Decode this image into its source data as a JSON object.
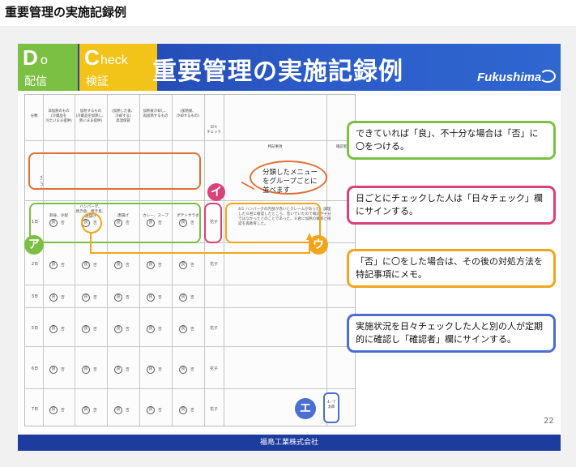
{
  "page": {
    "heading": "重要管理の実施記録例"
  },
  "slide": {
    "tile_do_big": "D",
    "tile_do_rest": "o",
    "tile_do_sub": "配信",
    "tile_check_big": "C",
    "tile_check_rest": "heck",
    "tile_check_sub": "検証",
    "title": "重要管理の実施記録例",
    "brand": "Fukushima",
    "page_number": "22",
    "footer": "福島工業株式会社"
  },
  "table": {
    "col_headers": [
      "分類",
      "非加熱のもの\n(冷蔵品を\n冷たいまま提供)",
      "加熱するもの\n(冷蔵品を加熱し、\n熱いまま提供)",
      "(加熱した後、\n冷却する)\n高温保管",
      "加熱後冷却し、\n再加熱するもの",
      "(加熱後、\n冷却するもの)",
      "日々\nチェック",
      "特記事項",
      "確認者"
    ],
    "menu_label": "メニュー",
    "menus": [
      "刺身、冷奴",
      "ハンバーグ、\n焼き魚、焼き鳥、\n唐揚げ",
      "唐揚げ",
      "カレー、スープ",
      "ポテトサラダ"
    ],
    "days": [
      "1日",
      "2日",
      "3日",
      "5日",
      "6日",
      "7日"
    ],
    "good": "良",
    "ng": "否",
    "signer": "花子",
    "note": "4/1 ハンバーグの内部が赤いとクレームがあった。調理した８君に確認したところ、急いでいたので確認が十分ではなかったとのことであった。８君に加熱の徹底と確認を再教育した。",
    "confirm": "4／7\n太郎"
  },
  "callouts": {
    "a": "ア",
    "i": "イ",
    "u": "ウ",
    "e": "エ",
    "bubble": "分類したメニュー\nをグループごとに\n並べます"
  },
  "explanations": [
    "できていれば「良」、不十分な場合は「否」に〇をつける。",
    "日ごとにチェックした人は「日々チェック」欄にサインする。",
    "「否」に〇をした場合は、その後の対処方法を特記事項にメモ。",
    "実施状況を日々チェックした人と別の人が定期的に確認し「確認者」欄にサインする。"
  ],
  "colors": {
    "header_blue": "#2b5cc9",
    "do_green": "#7bc043",
    "check_yellow": "#f2c318",
    "callout_green": "#7bc043",
    "callout_pink": "#d9417a",
    "callout_orange": "#f2a51a",
    "callout_blue": "#4a6fd1",
    "bubble_orange": "#e46f36"
  }
}
